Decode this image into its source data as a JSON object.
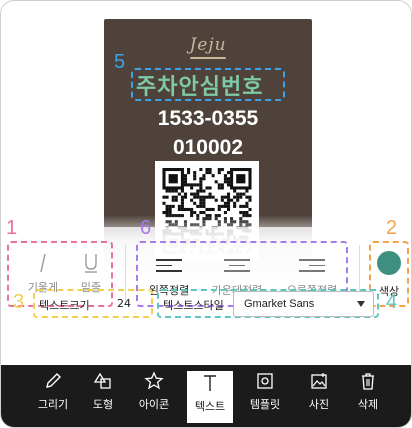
{
  "card": {
    "logo": "Jeju",
    "title": "주차안심번호",
    "phone": "1533-0355",
    "number": "010002"
  },
  "badges": {
    "b1": "1",
    "b2": "2",
    "b3": "3",
    "b4": "4",
    "b5": "5",
    "b6": "6"
  },
  "badge_colors": {
    "pink": "#e8729a",
    "orange": "#f5a34a",
    "purple": "#a77bf0",
    "yellow": "#f3cf4f",
    "teal": "#5cc6c2",
    "blue": "#3ea3e6"
  },
  "toolbar": {
    "italic": "기울게",
    "underline": "밑줄",
    "align_left": "왼쪽정렬",
    "align_center": "가운데정렬",
    "align_right": "오른쪽정렬",
    "color": "색상",
    "color_value": "#3f8f80",
    "font_size_label": "텍스트크기",
    "font_size_value": "24",
    "font_style_label": "텍스트스타일",
    "font_style_value": "Gmarket Sans"
  },
  "nav": {
    "draw": "그리기",
    "shape": "도형",
    "icon": "아이콘",
    "text": "텍스트",
    "template": "템플릿",
    "photo": "사진",
    "delete": "삭제"
  }
}
